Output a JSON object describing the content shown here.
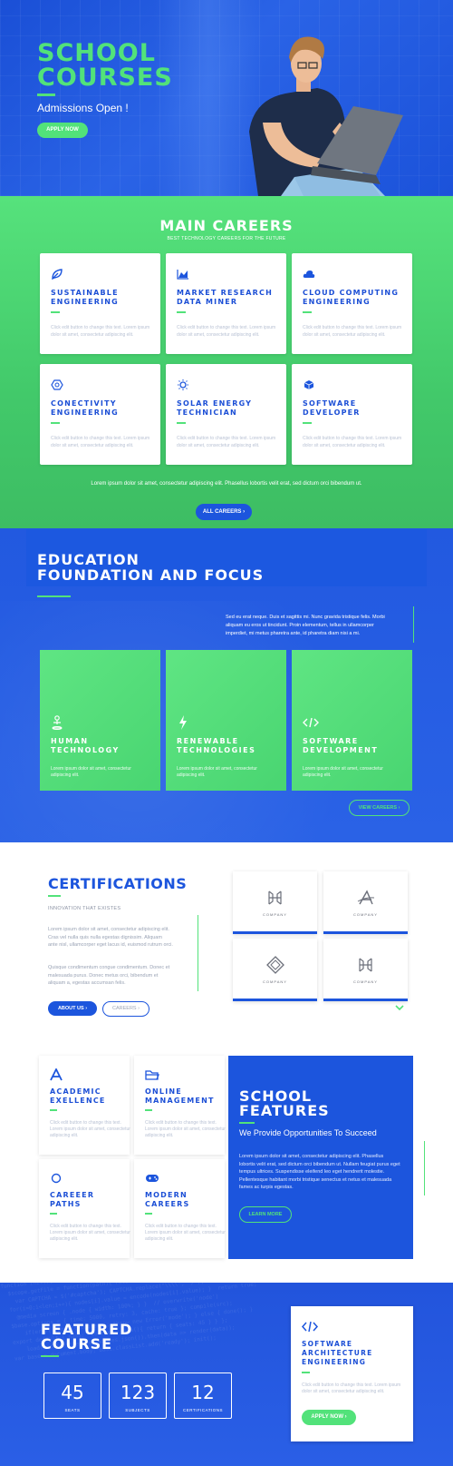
{
  "hero": {
    "title_line1": "SCHOOL",
    "title_line2": "COURSES",
    "subtitle": "Admissions Open !",
    "apply_button": "APPLY NOW"
  },
  "careers": {
    "title": "MAIN CAREERS",
    "subtitle": "BEST TECHNOLOGY CAREERS FOR THE FUTURE",
    "cards": [
      {
        "title": "SUSTAINABLE ENGINEERING",
        "icon": "leaf-icon",
        "text": "Click edit button to change this text. Lorem ipsum dolor sit amet, consectetur adipiscing elit."
      },
      {
        "title": "MARKET RESEARCH DATA MINER",
        "icon": "area-chart-icon",
        "text": "Click edit button to change this text. Lorem ipsum dolor sit amet, consectetur adipiscing elit."
      },
      {
        "title": "CLOUD COMPUTING ENGINEERING",
        "icon": "cloud-icon",
        "text": "Click edit button to change this text. Lorem ipsum dolor sit amet, consectetur adipiscing elit."
      },
      {
        "title": "CONECTIVITY ENGINEERING",
        "icon": "hexagon-icon",
        "text": "Click edit button to change this text. Lorem ipsum dolor sit amet, consectetur adipiscing elit."
      },
      {
        "title": "SOLAR ENERGY TECHNICIAN",
        "icon": "sun-icon",
        "text": "Click edit button to change this text. Lorem ipsum dolor sit amet, consectetur adipiscing elit."
      },
      {
        "title": "SOFTWARE DEVELOPER",
        "icon": "cube-icon",
        "text": "Click edit button to change this text. Lorem ipsum dolor sit amet, consectetur adipiscing elit."
      }
    ],
    "footer_text": "Lorem ipsum dolor sit amet, consectetur adipiscing elit. Phasellus lobortis velit erat, sed dictum orci bibendum ut.",
    "all_button": "ALL CAREERS ›"
  },
  "education": {
    "title_line1": "EDUCATION",
    "title_line2": "FOUNDATION AND FOCUS",
    "intro": "Sed eu erat neque. Duis et sagittis mi. Nunc gravida tristique felis. Morbi aliquam eu eros ut tincidunt. Proin elementum, tellus in ullamcorper imperdiet, mi metus pharetra ante, id pharetra diam nisi a mi.",
    "tiles": [
      {
        "title": "HUMAN TECHNOLOGY",
        "icon": "person-icon",
        "text": "Lorem ipsum dolor sit amet, consectetur adipiscing elit."
      },
      {
        "title": "RENEWABLE TECHNOLOGIES",
        "icon": "bolt-icon",
        "text": "Lorem ipsum dolor sit amet, consectetur adipiscing elit."
      },
      {
        "title": "SOFTWARE DEVELOPMENT",
        "icon": "code-icon",
        "text": "Lorem ipsum dolor sit amet, consectetur adipiscing elit."
      }
    ],
    "view_button": "VIEW CAREERS ›"
  },
  "certifications": {
    "title": "CERTIFICATIONS",
    "subtitle": "INNOVATION THAT EXISTES",
    "para1": "Lorem ipsum dolor sit amet, consectetur adipiscing elit. Cras vel nulla quis nulla egestas dignissim. Aliquam ante nisl, ullamcorper eget lacus id, euismod rutrum orci.",
    "para2": "Quisque condimentum congue condimentum. Donec et malesuada purus. Donec metus orci, bibendum et aliquam a, egestas accumsan felis.",
    "about_button": "ABOUT US ›",
    "careers_button": "CAREERS ›",
    "logos": [
      {
        "label": "COMPANY",
        "icon": "h-logo-icon"
      },
      {
        "label": "COMPANY",
        "icon": "a-logo-icon"
      },
      {
        "label": "COMPANY",
        "icon": "diamond-logo-icon"
      },
      {
        "label": "COMPANY",
        "icon": "h-logo-icon"
      }
    ]
  },
  "features": {
    "cards": [
      {
        "title": "ACADEMIC EXELLENCE",
        "icon": "letter-a-icon",
        "text": "Click edit button to change this text. Lorem ipsum dolor sit amet, consectetur adipiscing elit."
      },
      {
        "title": "ONLINE MANAGEMENT",
        "icon": "folder-icon",
        "text": "Click edit button to change this text. Lorem ipsum dolor sit amet, consectetur adipiscing elit."
      },
      {
        "title": "CAREEER PATHS",
        "icon": "circle-icon",
        "text": "Click edit button to change this text. Lorem ipsum dolor sit amet, consectetur adipiscing elit."
      },
      {
        "title": "MODERN CAREERS",
        "icon": "gamepad-icon",
        "text": "Click edit button to change this text. Lorem ipsum dolor sit amet, consectetur adipiscing elit."
      }
    ],
    "title_line1": "SCHOOL",
    "title_line2": "FEATURES",
    "tagline": "We Provide Opportunities To Succeed",
    "text": "Lorem ipsum dolor sit amet, consectetur adipiscing elit. Phasellus lobortis velit erat, sed dictum orci bibendum ut. Nullam feugiat purus eget tempus ultrices. Suspendisse eleifend leo eget hendrerit molestie. Pellentesque habitant morbi tristique senectus et netus et malesuada fames ac turpis egestas.",
    "learn_button": "LEARN MORE"
  },
  "featured": {
    "title_line1": "FEATURED",
    "title_line2": "COURSE",
    "stats": [
      {
        "value": "45",
        "label": "SEATS"
      },
      {
        "value": "123",
        "label": "SUBJECTS"
      },
      {
        "value": "12",
        "label": "CERTIFICATIONS"
      }
    ],
    "course_title": "SOFTWARE ARCHITECTURE ENGINEERING",
    "course_icon": "code-icon",
    "course_text": "Click edit button to change this text. Lorem ipsum dolor sit amet, consectetur adipiscing elit.",
    "apply_button": "APPLY NOW ›"
  },
  "colors": {
    "brand_blue": "#1c55dd",
    "brand_green": "#52e27a"
  }
}
